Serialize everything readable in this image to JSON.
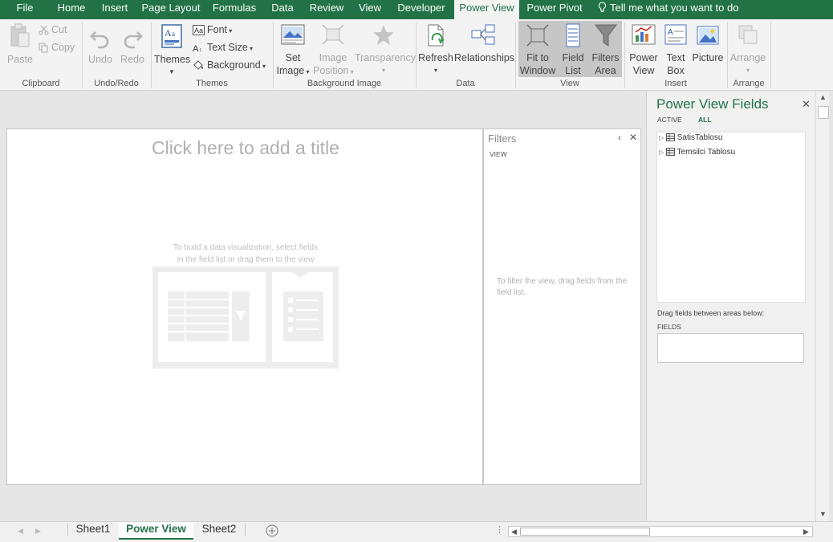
{
  "tabs": [
    {
      "label": "File"
    },
    {
      "label": "Home"
    },
    {
      "label": "Insert"
    },
    {
      "label": "Page Layout"
    },
    {
      "label": "Formulas"
    },
    {
      "label": "Data"
    },
    {
      "label": "Review"
    },
    {
      "label": "View"
    },
    {
      "label": "Developer"
    },
    {
      "label": "Power View"
    },
    {
      "label": "Power Pivot"
    }
  ],
  "active_tab": "Power View",
  "tell_me": "Tell me what you want to do",
  "ribbon": {
    "clipboard": {
      "paste": "Paste",
      "cut": "Cut",
      "copy": "Copy",
      "label": "Clipboard"
    },
    "undo_redo": {
      "undo": "Undo",
      "redo": "Redo",
      "label": "Undo/Redo"
    },
    "themes": {
      "themes": "Themes",
      "font": "Font",
      "text_size": "Text Size",
      "background": "Background",
      "label": "Themes"
    },
    "background_image": {
      "set_image_1": "Set",
      "set_image_2": "Image",
      "image_position_1": "Image",
      "image_position_2": "Position",
      "transparency": "Transparency",
      "label": "Background Image"
    },
    "data": {
      "refresh": "Refresh",
      "relationships": "Relationships",
      "label": "Data"
    },
    "view": {
      "fit_1": "Fit to",
      "fit_2": "Window",
      "field_1": "Field",
      "field_2": "List",
      "filters_1": "Filters",
      "filters_2": "Area",
      "label": "View"
    },
    "insert": {
      "power_1": "Power",
      "power_2": "View",
      "text_1": "Text",
      "text_2": "Box",
      "picture": "Picture",
      "label": "Insert"
    },
    "arrange": {
      "arrange": "Arrange",
      "label": "Arrange"
    }
  },
  "canvas": {
    "title_placeholder": "Click here to add a title",
    "hint_line1": "To build a data visualization, select fields",
    "hint_line2": "in the field list or drag them to the view"
  },
  "filters": {
    "title": "Filters",
    "view": "VIEW",
    "hint": "To filter the view, drag fields from the field list."
  },
  "fields_pane": {
    "title": "Power View Fields",
    "tab_active": "ACTIVE",
    "tab_all": "ALL",
    "tables": [
      "SatisTablosu",
      "Temsilci Tablosu"
    ],
    "drag_label": "Drag fields between areas below:",
    "fields_label": "FIELDS"
  },
  "sheets": [
    "Sheet1",
    "Power View",
    "Sheet2"
  ],
  "active_sheet": "Power View",
  "colors": {
    "accent": "#217346",
    "ribbon": "#f3f3f3",
    "selected": "#c6c6c6"
  }
}
